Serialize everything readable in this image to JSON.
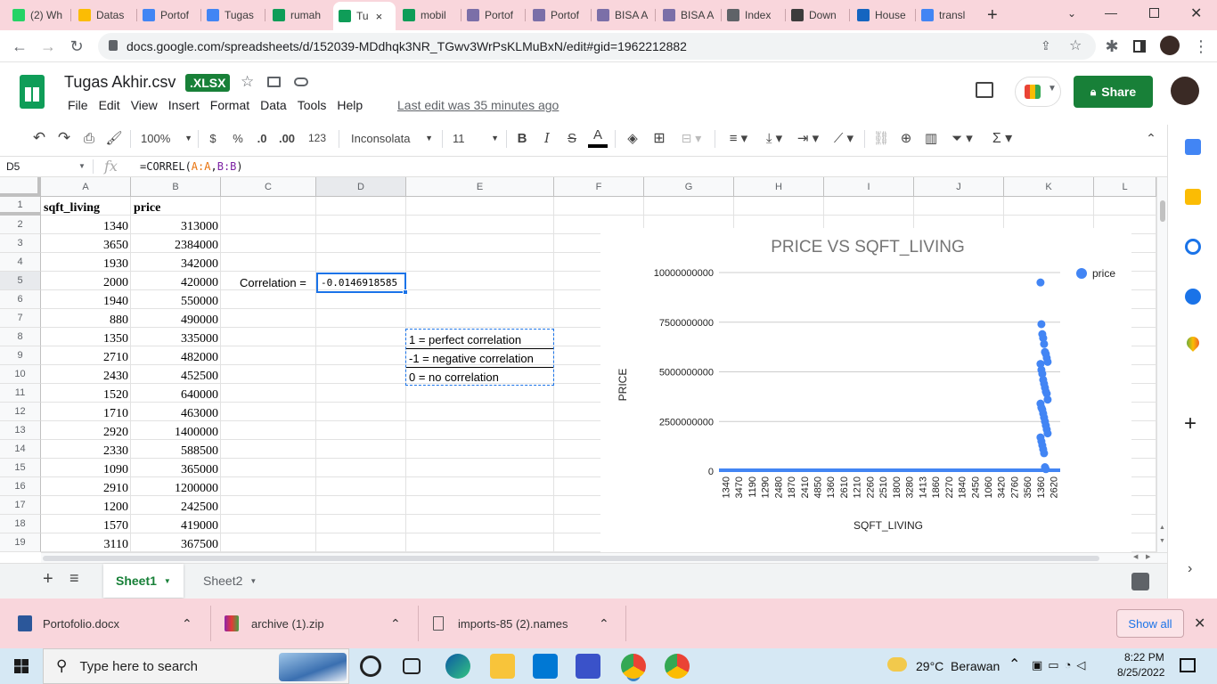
{
  "browser": {
    "tabs": [
      {
        "label": "(2) Wh",
        "color": "#25d366"
      },
      {
        "label": "Datas",
        "color": "#fbbc04"
      },
      {
        "label": "Portof",
        "color": "#4285f4"
      },
      {
        "label": "Tugas",
        "color": "#4285f4"
      },
      {
        "label": "rumah",
        "color": "#0f9d58"
      },
      {
        "label": "Tu",
        "color": "#0f9d58"
      },
      {
        "label": "mobil",
        "color": "#0f9d58"
      },
      {
        "label": "Portof",
        "color": "#7b6fa8"
      },
      {
        "label": "Portof",
        "color": "#7b6fa8"
      },
      {
        "label": "BISA A",
        "color": "#7b6fa8"
      },
      {
        "label": "BISA A",
        "color": "#7b6fa8"
      },
      {
        "label": "Index",
        "color": "#5f6368"
      },
      {
        "label": "Down",
        "color": "#3c3c3c"
      },
      {
        "label": "House",
        "color": "#1565c0"
      },
      {
        "label": "transl",
        "color": "#4285f4"
      }
    ],
    "active_tab_close": "×",
    "new_tab": "+",
    "url": "docs.google.com/spreadsheets/d/152039-MDdhqk3NR_TGwv3WrPsKLMuBxN/edit#gid=1962212882"
  },
  "doc": {
    "title": "Tugas Akhir.csv",
    "badge": ".XLSX",
    "menus": [
      "File",
      "Edit",
      "View",
      "Insert",
      "Format",
      "Data",
      "Tools",
      "Help"
    ],
    "last_edit": "Last edit was 35 minutes ago",
    "share_label": "Share"
  },
  "toolbar": {
    "zoom": "100%",
    "currency": "$",
    "percent": "%",
    "dec_decrease": ".0",
    "dec_increase": ".00",
    "number_format": "123",
    "font": "Inconsolata",
    "font_size": "11",
    "bold": "B",
    "italic": "I",
    "strike": "S",
    "text_color": "A"
  },
  "formula_bar": {
    "cell_ref": "D5",
    "fx": "fx",
    "formula_prefix": "=CORREL(",
    "arg1": "A:A",
    "comma": ",",
    "arg2": "B:B",
    "formula_suffix": ")"
  },
  "grid": {
    "columns": [
      "A",
      "B",
      "C",
      "D",
      "E",
      "F",
      "G",
      "H",
      "I",
      "J",
      "K",
      "L"
    ],
    "rows": [
      "1",
      "2",
      "3",
      "4",
      "5",
      "6",
      "7",
      "8",
      "9",
      "10",
      "11",
      "12",
      "13",
      "14",
      "15",
      "16",
      "17",
      "18",
      "19"
    ],
    "header_a": "sqft_living",
    "header_b": "price",
    "data": [
      [
        "1340",
        "313000"
      ],
      [
        "3650",
        "2384000"
      ],
      [
        "1930",
        "342000"
      ],
      [
        "2000",
        "420000"
      ],
      [
        "1940",
        "550000"
      ],
      [
        "880",
        "490000"
      ],
      [
        "1350",
        "335000"
      ],
      [
        "2710",
        "482000"
      ],
      [
        "2430",
        "452500"
      ],
      [
        "1520",
        "640000"
      ],
      [
        "1710",
        "463000"
      ],
      [
        "2920",
        "1400000"
      ],
      [
        "2330",
        "588500"
      ],
      [
        "1090",
        "365000"
      ],
      [
        "2910",
        "1200000"
      ],
      [
        "1200",
        "242500"
      ],
      [
        "1570",
        "419000"
      ],
      [
        "3110",
        "367500"
      ]
    ],
    "corr_label": "Correlation =",
    "corr_value": "-0.0146918585",
    "legend_notes": [
      "1 = perfect correlation",
      "-1 = negative correlation",
      "0 = no correlation"
    ]
  },
  "chart_data": {
    "type": "scatter",
    "title": "PRICE VS SQFT_LIVING",
    "xlabel": "SQFT_LIVING",
    "ylabel": "PRICE",
    "legend": "price",
    "legend_position": "top-right",
    "series_color": "#4285f4",
    "y_ticks": [
      "0",
      "2500000000",
      "5000000000",
      "7500000000",
      "10000000000"
    ],
    "ylim": [
      0,
      10000000000
    ],
    "x_tick_labels": [
      "1340",
      "3470",
      "1190",
      "1290",
      "2480",
      "1870",
      "2410",
      "4850",
      "1360",
      "2610",
      "1210",
      "2260",
      "2510",
      "1800",
      "3280",
      "1413",
      "1860",
      "2270",
      "1840",
      "2450",
      "1060",
      "3420",
      "2760",
      "3560",
      "1360",
      "2620"
    ],
    "points_y": [
      9500000000,
      7400000000,
      6900000000,
      6700000000,
      6400000000,
      6000000000,
      5900000000,
      5700000000,
      5500000000,
      5400000000,
      5100000000,
      4900000000,
      4600000000,
      4400000000,
      4200000000,
      4000000000,
      3900000000,
      3600000000,
      3400000000,
      3200000000,
      3100000000,
      2900000000,
      2700000000,
      2500000000,
      2300000000,
      2100000000,
      1900000000,
      1700000000,
      1500000000,
      1300000000,
      1100000000,
      900000000,
      200000000,
      100000000
    ],
    "grid": true
  },
  "sheets": {
    "tabs": [
      "Sheet1",
      "Sheet2"
    ],
    "add": "+",
    "all": "≡"
  },
  "downloads": {
    "items": [
      "Portofolio.docx",
      "archive (1).zip",
      "imports-85 (2).names"
    ],
    "show_all": "Show all",
    "close": "✕"
  },
  "taskbar": {
    "search_placeholder": "Type here to search",
    "weather": "29°C  Berawan",
    "time": "8:22 PM",
    "date": "8/25/2022"
  }
}
